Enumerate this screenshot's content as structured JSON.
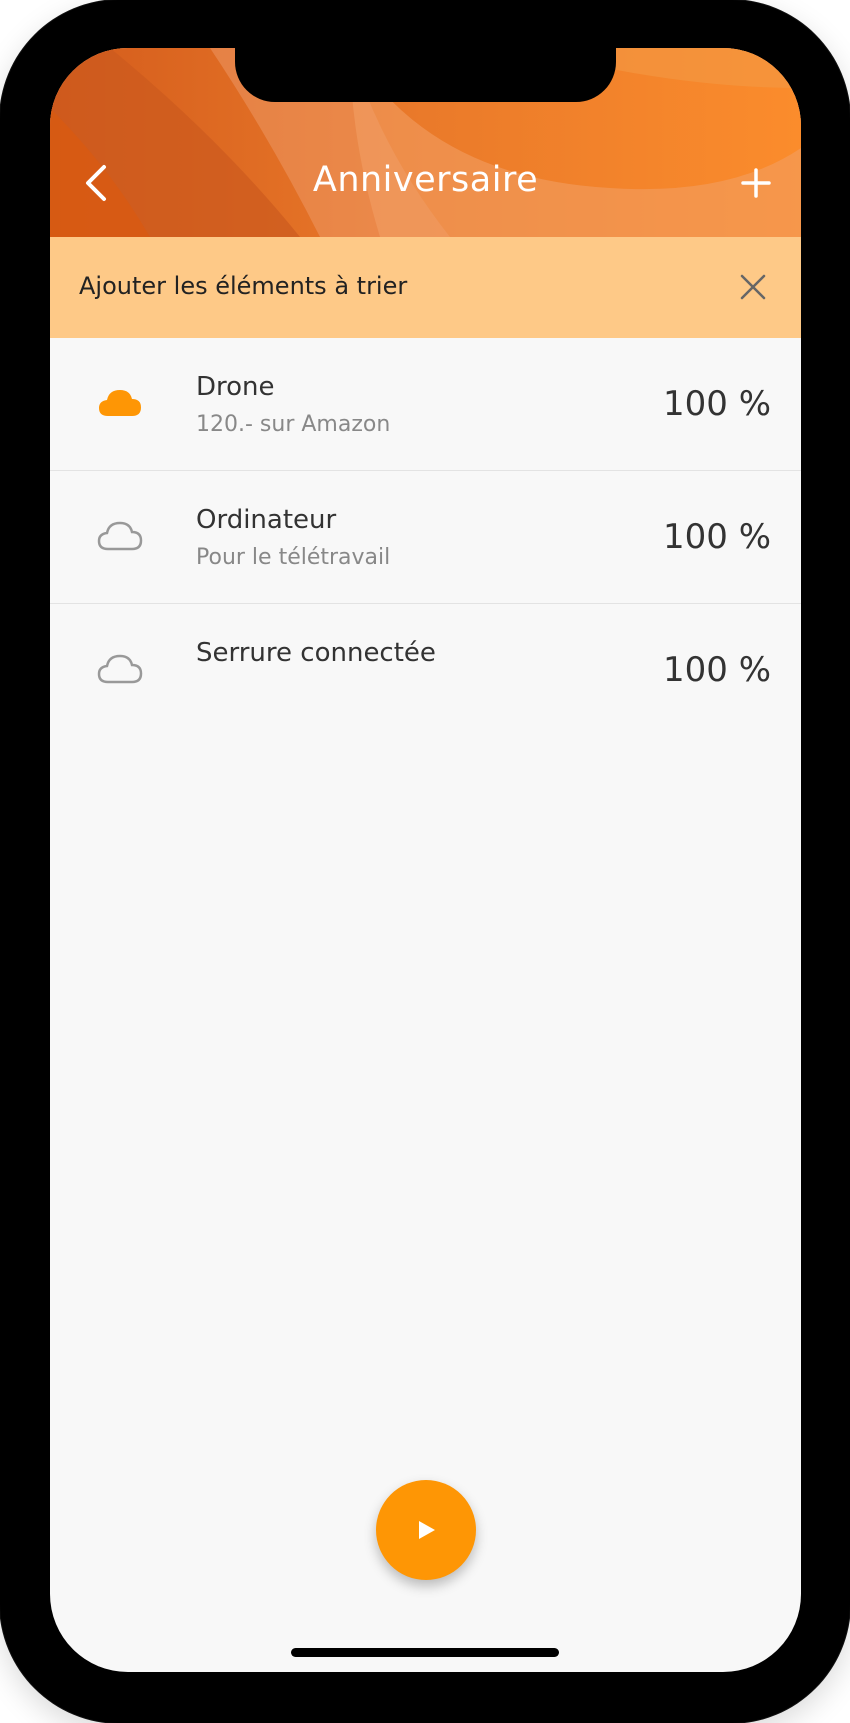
{
  "header": {
    "title": "Anniversaire",
    "back_icon": "chevron-left-icon",
    "add_icon": "plus-icon"
  },
  "banner": {
    "text": "Ajouter les éléments à trier",
    "close_icon": "close-icon"
  },
  "items": [
    {
      "name": "Drone",
      "subtitle": "120.- sur Amazon",
      "percent": "100 %",
      "icon": "cloud-filled-icon",
      "selected": true
    },
    {
      "name": "Ordinateur",
      "subtitle": "Pour le télétravail",
      "percent": "100 %",
      "icon": "cloud-outline-icon",
      "selected": false
    },
    {
      "name": "Serrure connectée",
      "subtitle": "",
      "percent": "100 %",
      "icon": "cloud-outline-icon",
      "selected": false
    }
  ],
  "fab": {
    "icon": "play-icon"
  },
  "colors": {
    "accent": "#fe9605",
    "header": "#ea7a2a",
    "banner": "#fec987",
    "icon_inactive": "#999999"
  }
}
